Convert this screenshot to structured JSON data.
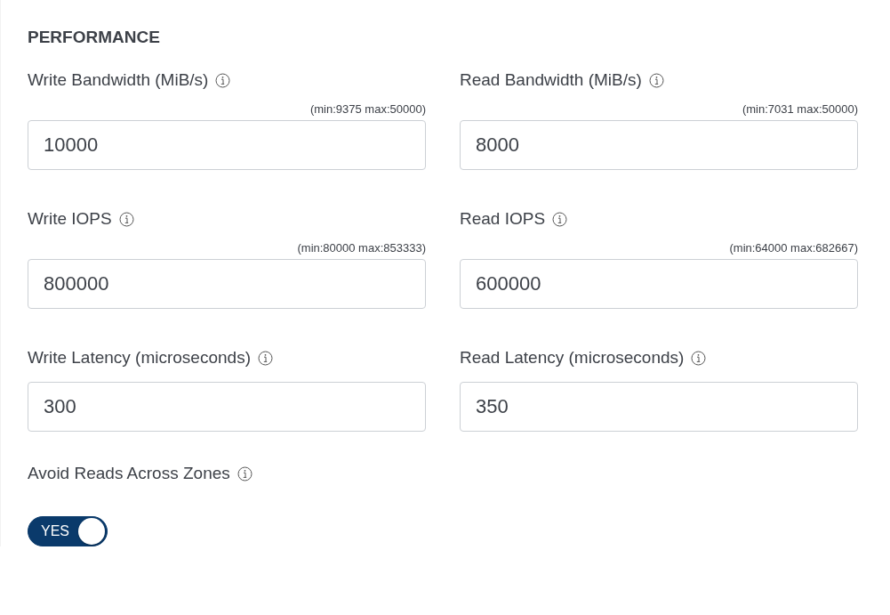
{
  "section_title": "PERFORMANCE",
  "fields": [
    {
      "label": "Write Bandwidth (MiB/s)",
      "hint": "(min:9375 max:50000)",
      "value": "10000"
    },
    {
      "label": "Read Bandwidth (MiB/s)",
      "hint": "(min:7031 max:50000)",
      "value": "8000"
    },
    {
      "label": "Write IOPS",
      "hint": "(min:80000 max:853333)",
      "value": "800000"
    },
    {
      "label": "Read IOPS",
      "hint": "(min:64000 max:682667)",
      "value": "600000"
    },
    {
      "label": "Write Latency (microseconds)",
      "value": "300"
    },
    {
      "label": "Read Latency (microseconds)",
      "value": "350"
    }
  ],
  "toggle": {
    "label": "Avoid Reads Across Zones",
    "on": true,
    "text": "YES"
  }
}
